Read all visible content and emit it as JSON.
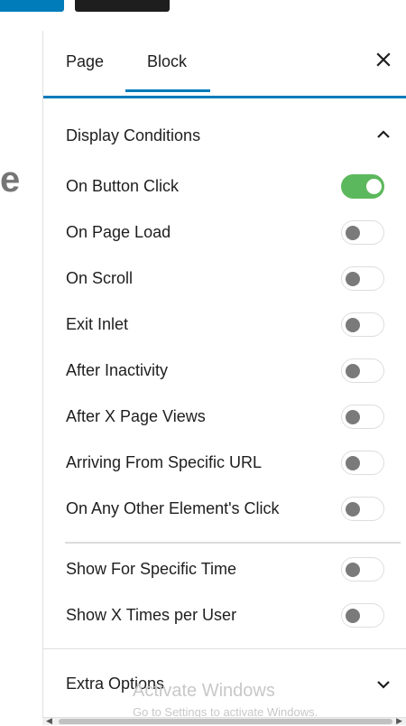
{
  "tabs": {
    "page": "Page",
    "block": "Block",
    "active": "Block"
  },
  "canvas": {
    "visible_letter": "e"
  },
  "panel": {
    "title": "Display Conditions",
    "expanded": true,
    "conditions": [
      {
        "label": "On Button Click",
        "enabled": true
      },
      {
        "label": "On Page Load",
        "enabled": false
      },
      {
        "label": "On Scroll",
        "enabled": false
      },
      {
        "label": "Exit Inlet",
        "enabled": false
      },
      {
        "label": "After Inactivity",
        "enabled": false
      },
      {
        "label": "After X Page Views",
        "enabled": false
      },
      {
        "label": "Arriving From Specific URL",
        "enabled": false
      },
      {
        "label": "On Any Other Element's Click",
        "enabled": false
      }
    ],
    "extra_conditions": [
      {
        "label": "Show For Specific Time",
        "enabled": false
      },
      {
        "label": "Show X Times per User",
        "enabled": false
      }
    ]
  },
  "extra_options": {
    "title": "Extra Options",
    "expanded": false
  },
  "watermark": {
    "title": "Activate Windows",
    "subtitle": "Go to Settings to activate Windows."
  },
  "colors": {
    "accent": "#007cba",
    "toggle_on": "#5cb85c",
    "toggle_off_knob": "#7a7a7a"
  },
  "icons": {
    "close": "close-icon",
    "collapse": "chevron-up-icon",
    "expand": "chevron-down-icon"
  }
}
